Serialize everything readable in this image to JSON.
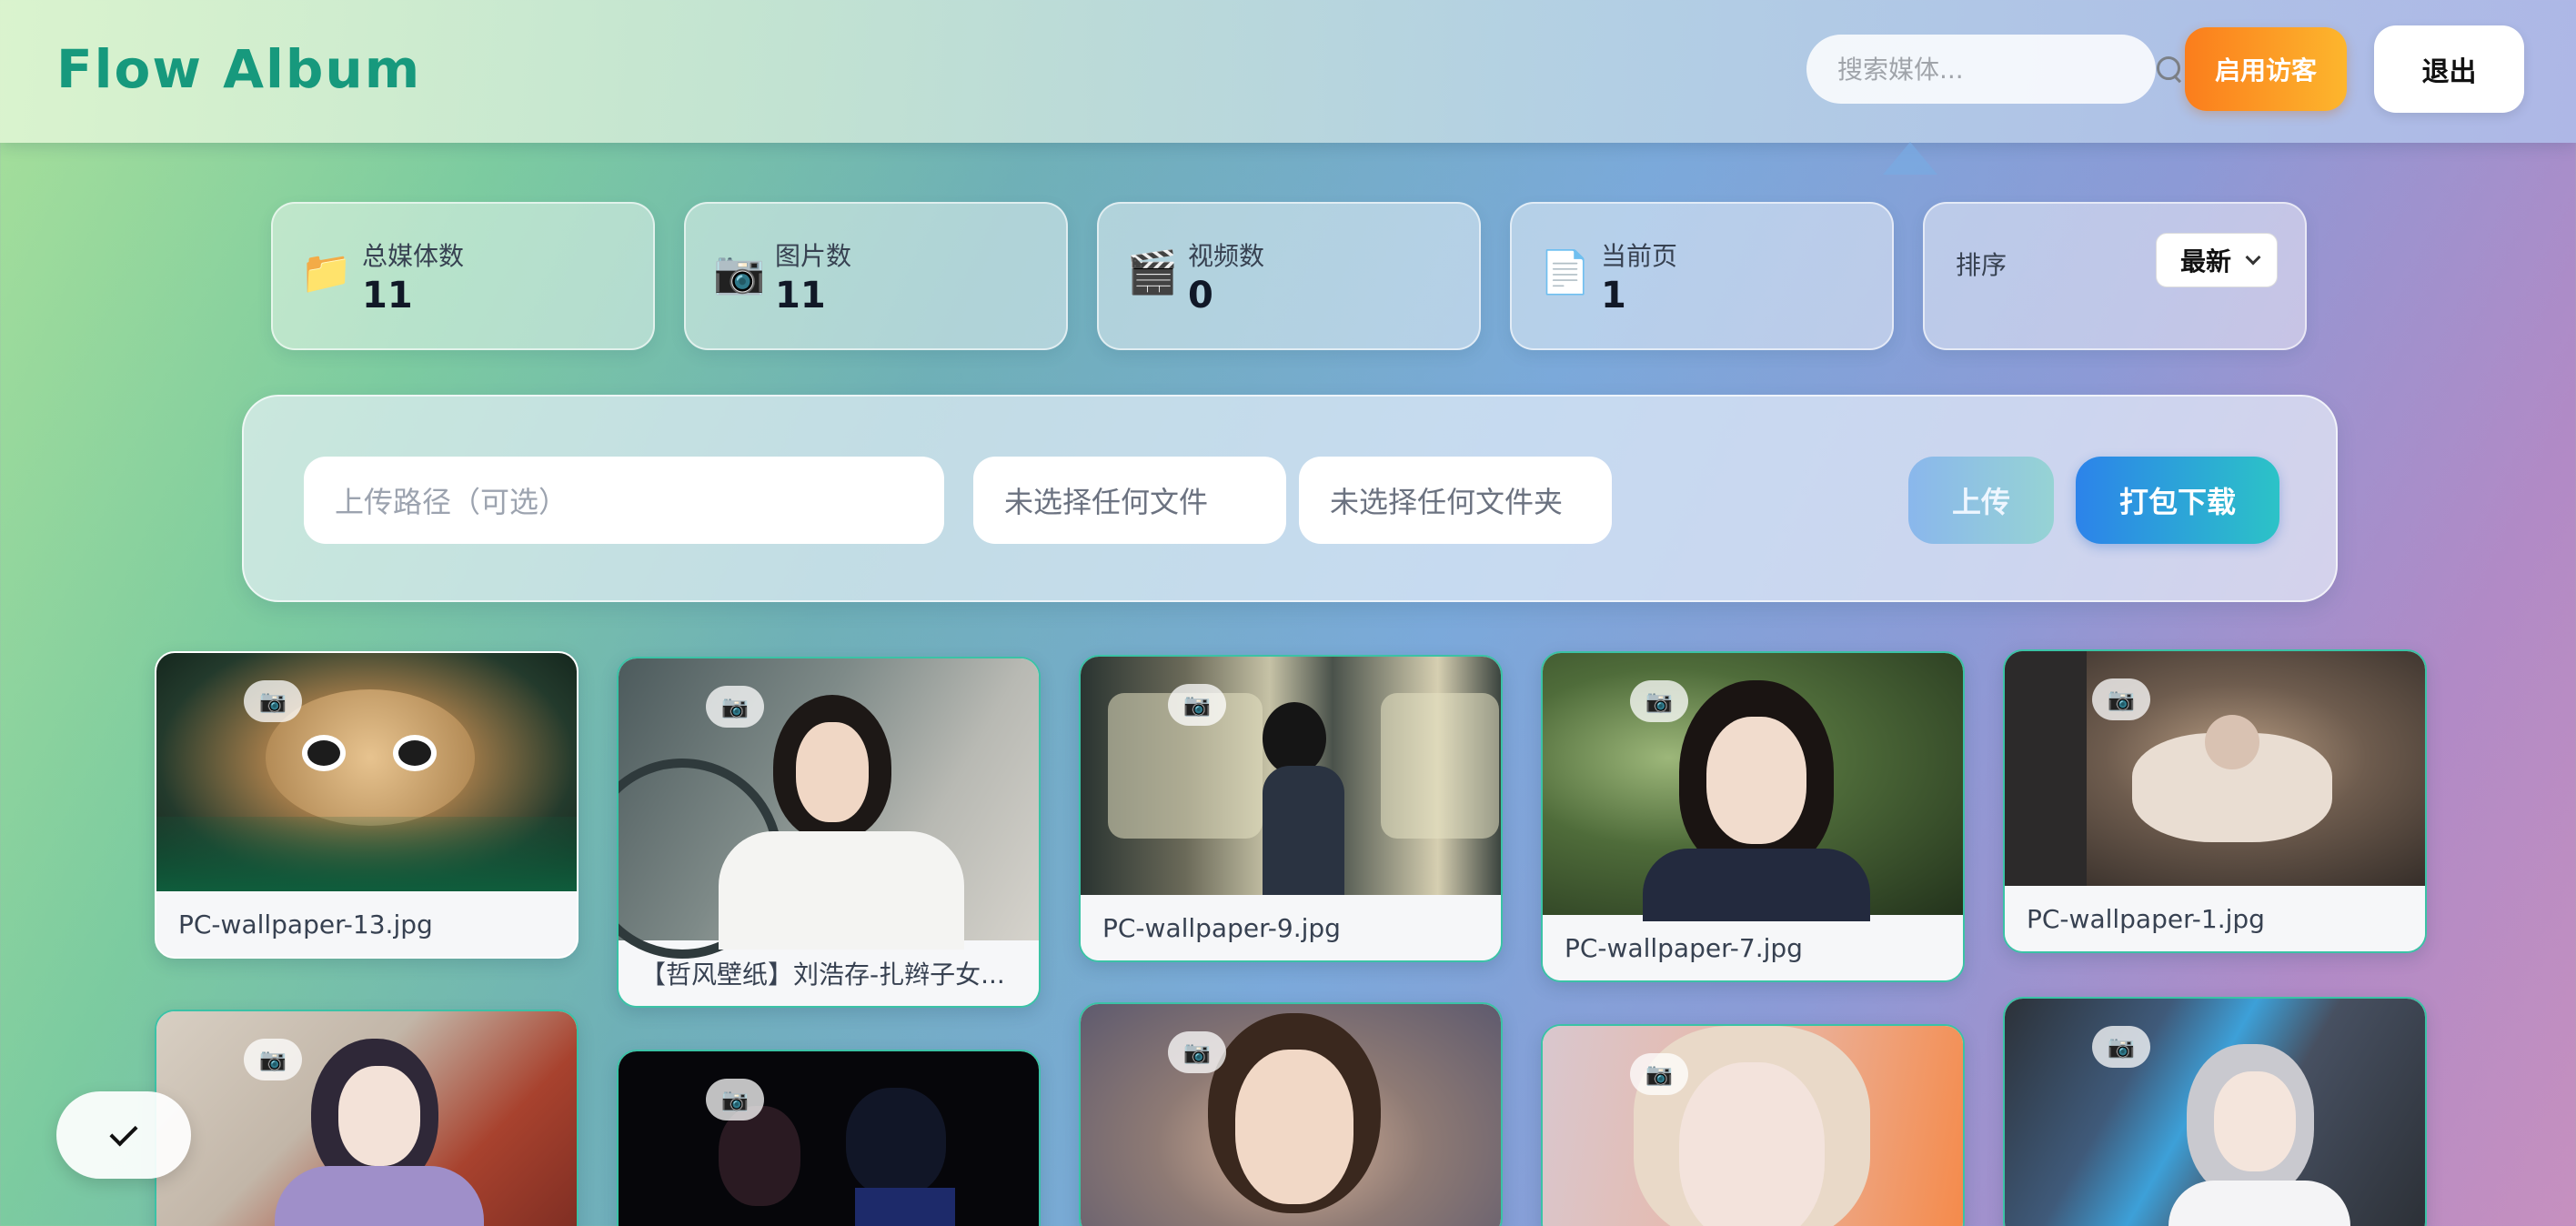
{
  "app": {
    "title": "Flow Album"
  },
  "header": {
    "search_placeholder": "搜索媒体...",
    "guest_button": "启用访客",
    "logout_button": "退出"
  },
  "stats": [
    {
      "label": "总媒体数",
      "value": "11",
      "icon": "folder-icon"
    },
    {
      "label": "图片数",
      "value": "11",
      "icon": "camera-icon"
    },
    {
      "label": "视频数",
      "value": "0",
      "icon": "clapper-icon"
    },
    {
      "label": "当前页",
      "value": "1",
      "icon": "page-icon"
    }
  ],
  "sort": {
    "label": "排序",
    "selected": "最新"
  },
  "upload": {
    "path_placeholder": "上传路径（可选）",
    "file_input": "未选择任何文件",
    "folder_input": "未选择任何文件夹",
    "upload_button": "上传",
    "download_button": "打包下载"
  },
  "gallery": [
    {
      "caption": "PC-wallpaper-13.jpg",
      "badge": "📷"
    },
    {
      "caption": "【哲风壁纸】刘浩存-扎辫子女...",
      "badge": "📷"
    },
    {
      "caption": "PC-wallpaper-9.jpg",
      "badge": "📷"
    },
    {
      "caption": "PC-wallpaper-7.jpg",
      "badge": "📷"
    },
    {
      "caption": "PC-wallpaper-1.jpg",
      "badge": "📷"
    },
    {
      "caption": "",
      "badge": "📷"
    },
    {
      "caption": "",
      "badge": "📷"
    },
    {
      "caption": "",
      "badge": "📷"
    },
    {
      "caption": "",
      "badge": "📷"
    },
    {
      "caption": "",
      "badge": "📷"
    }
  ],
  "colors": {
    "brand": "#17997d",
    "guest_gradient": [
      "#fb7d1c",
      "#fdb62d"
    ],
    "download_gradient": [
      "#2c83ea",
      "#2cc3c7"
    ],
    "card_border": "#3bc2a6"
  }
}
